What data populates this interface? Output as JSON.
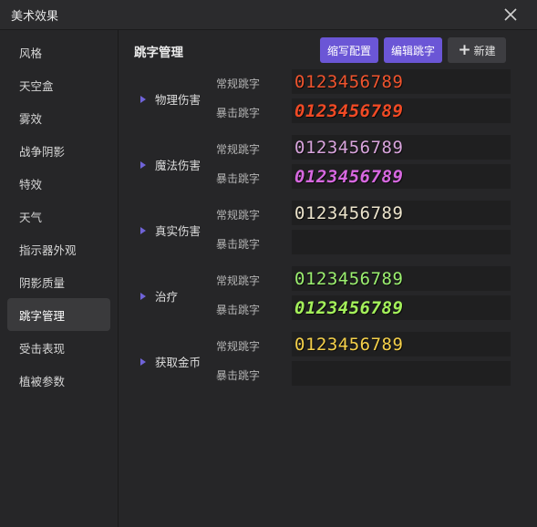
{
  "window": {
    "title": "美术效果"
  },
  "sidebar": {
    "items": [
      {
        "label": "风格"
      },
      {
        "label": "天空盒"
      },
      {
        "label": "雾效"
      },
      {
        "label": "战争阴影"
      },
      {
        "label": "特效"
      },
      {
        "label": "天气"
      },
      {
        "label": "指示器外观"
      },
      {
        "label": "阴影质量"
      },
      {
        "label": "跳字管理",
        "active": true
      },
      {
        "label": "受击表现"
      },
      {
        "label": "植被参数"
      }
    ]
  },
  "main": {
    "title": "跳字管理",
    "buttons": {
      "scale": "缩写配置",
      "edit": "编辑跳字",
      "new": "新建"
    },
    "groups": [
      {
        "name": "物理伤害",
        "normal_label": "常规跳字",
        "crit_label": "暴击跳字",
        "normal_text": "0123456789",
        "crit_text": "0123456789",
        "normal_color": "#f0542e",
        "crit_color": "#f04a25"
      },
      {
        "name": "魔法伤害",
        "normal_label": "常规跳字",
        "crit_label": "暴击跳字",
        "normal_text": "0123456789",
        "crit_text": "0123456789",
        "normal_color": "#d8a4dc",
        "crit_color": "#d768e0"
      },
      {
        "name": "真实伤害",
        "normal_label": "常规跳字",
        "crit_label": "暴击跳字",
        "normal_text": "0123456789",
        "crit_text": "",
        "normal_color": "#ece4cc",
        "crit_color": ""
      },
      {
        "name": "治疗",
        "normal_label": "常规跳字",
        "crit_label": "暴击跳字",
        "normal_text": "0123456789",
        "crit_text": "0123456789",
        "normal_color": "#9cf070",
        "crit_color": "#a4f05a"
      },
      {
        "name": "获取金币",
        "normal_label": "常规跳字",
        "crit_label": "暴击跳字",
        "normal_text": "0123456789",
        "crit_text": "",
        "normal_color": "#f5d04a",
        "crit_color": ""
      }
    ]
  }
}
